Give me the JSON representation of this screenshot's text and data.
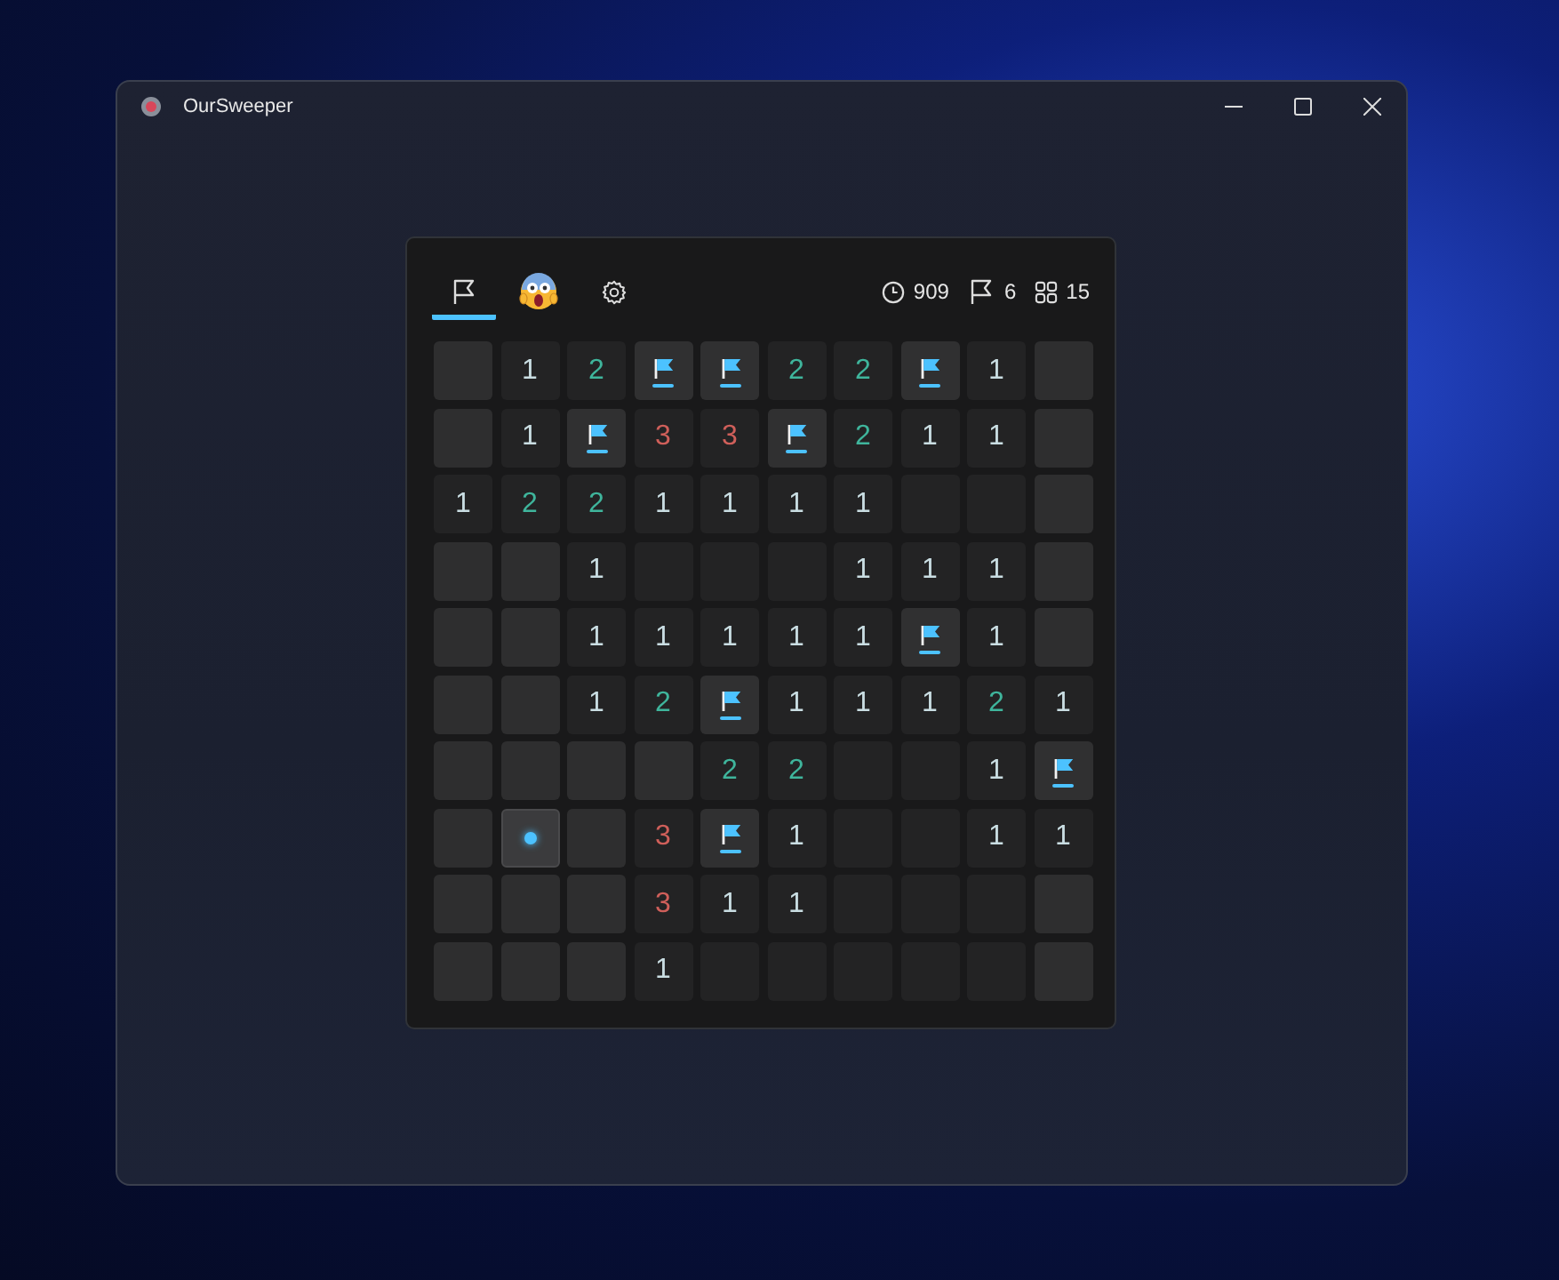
{
  "window": {
    "title": "OurSweeper"
  },
  "toolbar": {
    "tabs": [
      {
        "kind": "flag",
        "selected": true
      },
      {
        "kind": "face",
        "selected": false
      },
      {
        "kind": "settings",
        "selected": false
      }
    ],
    "stats": [
      {
        "kind": "clock",
        "value": "909"
      },
      {
        "kind": "flag",
        "value": "6"
      },
      {
        "kind": "grid",
        "value": "15"
      }
    ]
  },
  "board": {
    "rows": [
      [
        {
          "kind": "hidden"
        },
        {
          "kind": "number",
          "text": "1",
          "color": "#c9dde2"
        },
        {
          "kind": "number",
          "text": "2",
          "color": "#3fb59c"
        },
        {
          "kind": "flag"
        },
        {
          "kind": "flag"
        },
        {
          "kind": "number",
          "text": "2",
          "color": "#3fb59c"
        },
        {
          "kind": "number",
          "text": "2",
          "color": "#3fb59c"
        },
        {
          "kind": "flag"
        },
        {
          "kind": "number",
          "text": "1",
          "color": "#c9dde2"
        },
        {
          "kind": "hidden"
        }
      ],
      [
        {
          "kind": "hidden"
        },
        {
          "kind": "number",
          "text": "1",
          "color": "#c9dde2"
        },
        {
          "kind": "flag"
        },
        {
          "kind": "number",
          "text": "3",
          "color": "#cf5f5a"
        },
        {
          "kind": "number",
          "text": "3",
          "color": "#cf5f5a"
        },
        {
          "kind": "flag"
        },
        {
          "kind": "number",
          "text": "2",
          "color": "#3fb59c"
        },
        {
          "kind": "number",
          "text": "1",
          "color": "#c9dde2"
        },
        {
          "kind": "number",
          "text": "1",
          "color": "#c9dde2"
        },
        {
          "kind": "hidden"
        }
      ],
      [
        {
          "kind": "number",
          "text": "1",
          "color": "#c9dde2"
        },
        {
          "kind": "number",
          "text": "2",
          "color": "#3fb59c"
        },
        {
          "kind": "number",
          "text": "2",
          "color": "#3fb59c"
        },
        {
          "kind": "number",
          "text": "1",
          "color": "#c9dde2"
        },
        {
          "kind": "number",
          "text": "1",
          "color": "#c9dde2"
        },
        {
          "kind": "number",
          "text": "1",
          "color": "#c9dde2"
        },
        {
          "kind": "number",
          "text": "1",
          "color": "#c9dde2"
        },
        {
          "kind": "empty"
        },
        {
          "kind": "empty"
        },
        {
          "kind": "hidden"
        }
      ],
      [
        {
          "kind": "hidden"
        },
        {
          "kind": "hidden"
        },
        {
          "kind": "number",
          "text": "1",
          "color": "#c9dde2"
        },
        {
          "kind": "empty"
        },
        {
          "kind": "empty"
        },
        {
          "kind": "empty"
        },
        {
          "kind": "number",
          "text": "1",
          "color": "#c9dde2"
        },
        {
          "kind": "number",
          "text": "1",
          "color": "#c9dde2"
        },
        {
          "kind": "number",
          "text": "1",
          "color": "#c9dde2"
        },
        {
          "kind": "hidden"
        }
      ],
      [
        {
          "kind": "hidden"
        },
        {
          "kind": "hidden"
        },
        {
          "kind": "number",
          "text": "1",
          "color": "#c9dde2"
        },
        {
          "kind": "number",
          "text": "1",
          "color": "#c9dde2"
        },
        {
          "kind": "number",
          "text": "1",
          "color": "#c9dde2"
        },
        {
          "kind": "number",
          "text": "1",
          "color": "#c9dde2"
        },
        {
          "kind": "number",
          "text": "1",
          "color": "#c9dde2"
        },
        {
          "kind": "flag"
        },
        {
          "kind": "number",
          "text": "1",
          "color": "#c9dde2"
        },
        {
          "kind": "hidden"
        }
      ],
      [
        {
          "kind": "hidden"
        },
        {
          "kind": "hidden"
        },
        {
          "kind": "number",
          "text": "1",
          "color": "#c9dde2"
        },
        {
          "kind": "number",
          "text": "2",
          "color": "#3fb59c"
        },
        {
          "kind": "flag"
        },
        {
          "kind": "number",
          "text": "1",
          "color": "#c9dde2"
        },
        {
          "kind": "number",
          "text": "1",
          "color": "#c9dde2"
        },
        {
          "kind": "number",
          "text": "1",
          "color": "#c9dde2"
        },
        {
          "kind": "number",
          "text": "2",
          "color": "#3fb59c"
        },
        {
          "kind": "number",
          "text": "1",
          "color": "#c9dde2"
        }
      ],
      [
        {
          "kind": "hidden"
        },
        {
          "kind": "hidden"
        },
        {
          "kind": "hidden"
        },
        {
          "kind": "hidden"
        },
        {
          "kind": "number",
          "text": "2",
          "color": "#3fb59c"
        },
        {
          "kind": "number",
          "text": "2",
          "color": "#3fb59c"
        },
        {
          "kind": "empty"
        },
        {
          "kind": "empty"
        },
        {
          "kind": "number",
          "text": "1",
          "color": "#c9dde2"
        },
        {
          "kind": "flag"
        }
      ],
      [
        {
          "kind": "hidden"
        },
        {
          "kind": "cursor"
        },
        {
          "kind": "hidden"
        },
        {
          "kind": "number",
          "text": "3",
          "color": "#cf5f5a"
        },
        {
          "kind": "flag"
        },
        {
          "kind": "number",
          "text": "1",
          "color": "#c9dde2"
        },
        {
          "kind": "empty"
        },
        {
          "kind": "empty"
        },
        {
          "kind": "number",
          "text": "1",
          "color": "#c9dde2"
        },
        {
          "kind": "number",
          "text": "1",
          "color": "#c9dde2"
        }
      ],
      [
        {
          "kind": "hidden"
        },
        {
          "kind": "hidden"
        },
        {
          "kind": "hidden"
        },
        {
          "kind": "number",
          "text": "3",
          "color": "#cf5f5a"
        },
        {
          "kind": "number",
          "text": "1",
          "color": "#c9dde2"
        },
        {
          "kind": "number",
          "text": "1",
          "color": "#c9dde2"
        },
        {
          "kind": "empty"
        },
        {
          "kind": "empty"
        },
        {
          "kind": "empty"
        },
        {
          "kind": "hidden"
        }
      ],
      [
        {
          "kind": "hidden"
        },
        {
          "kind": "hidden"
        },
        {
          "kind": "hidden"
        },
        {
          "kind": "number",
          "text": "1",
          "color": "#c9dde2"
        },
        {
          "kind": "empty"
        },
        {
          "kind": "empty"
        },
        {
          "kind": "empty"
        },
        {
          "kind": "empty"
        },
        {
          "kind": "empty"
        },
        {
          "kind": "hidden"
        }
      ]
    ]
  }
}
